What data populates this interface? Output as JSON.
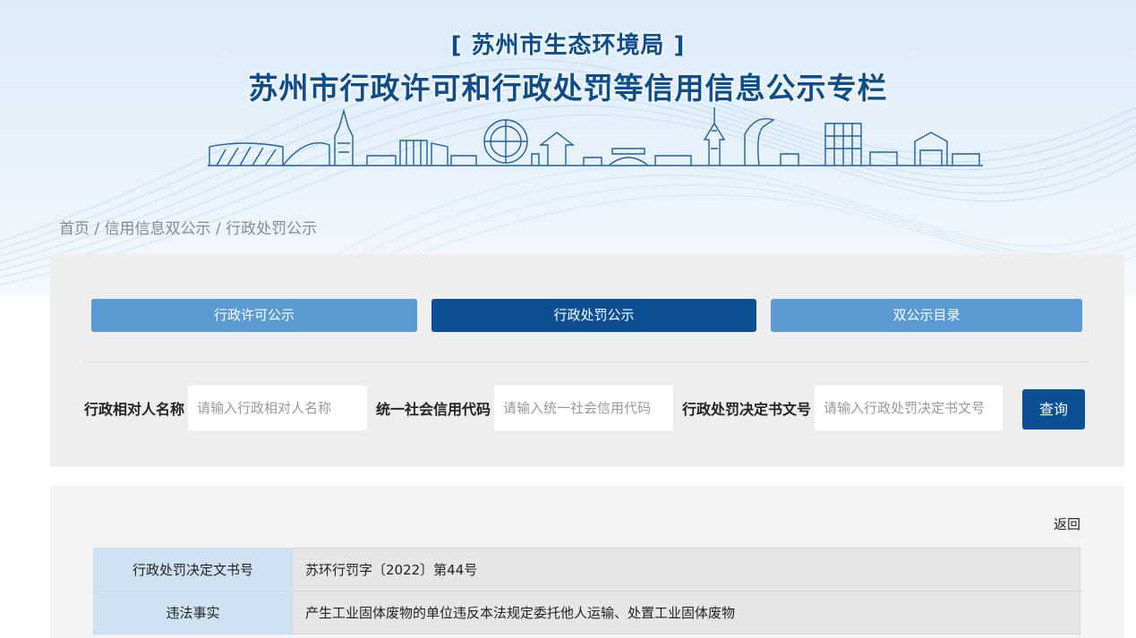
{
  "header": {
    "subtitle": "[ 苏州市生态环境局 ]",
    "title": "苏州市行政许可和行政处罚等信用信息公示专栏"
  },
  "breadcrumb": {
    "home": "首页",
    "sep1": " / ",
    "level2": "信用信息双公示",
    "sep2": " / ",
    "current": "行政处罚公示"
  },
  "tabs": [
    {
      "label": "行政许可公示",
      "active": false
    },
    {
      "label": "行政处罚公示",
      "active": true
    },
    {
      "label": "双公示目录",
      "active": false
    }
  ],
  "search": {
    "fields": [
      {
        "label": "行政相对人名称",
        "placeholder": "请输入行政相对人名称"
      },
      {
        "label": "统一社会信用代码",
        "placeholder": "请输入统一社会信用代码"
      },
      {
        "label": "行政处罚决定书文号",
        "placeholder": "请输入行政处罚决定书文号"
      }
    ],
    "button_label": "查询"
  },
  "detail": {
    "back_label": "返回",
    "rows": [
      {
        "key": "行政处罚决定文书号",
        "value": "苏环行罚字〔2022〕第44号"
      },
      {
        "key": "违法事实",
        "value": "产生工业固体废物的单位违反本法规定委托他人运输、处置工业固体废物"
      }
    ]
  },
  "colors": {
    "brand_blue": "#0c4f93",
    "tab_light": "#5a9ad2",
    "title_text": "#0d4d8c"
  }
}
